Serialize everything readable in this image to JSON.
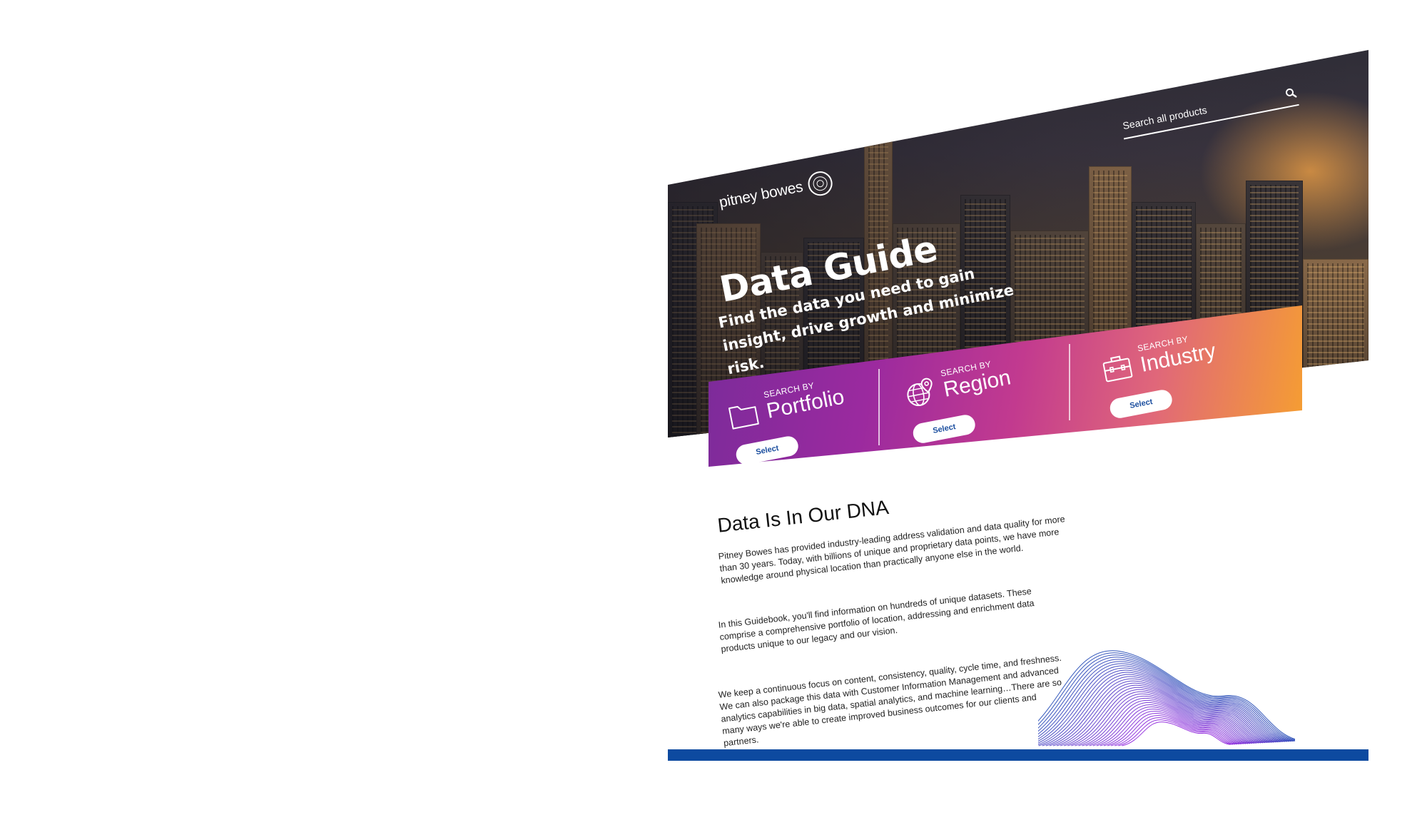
{
  "brand": {
    "name": "pitney bowes"
  },
  "search": {
    "placeholder": "Search all products"
  },
  "hero": {
    "title": "Data Guide",
    "subtitle": "Find the data you need to gain insight, drive growth and minimize risk."
  },
  "categories": [
    {
      "prefix": "SEARCH BY",
      "label": "Portfolio",
      "icon": "folder-icon",
      "button": "Select"
    },
    {
      "prefix": "SEARCH BY",
      "label": "Region",
      "icon": "globe-pin-icon",
      "button": "Select"
    },
    {
      "prefix": "SEARCH BY",
      "label": "Industry",
      "icon": "briefcase-icon",
      "button": "Select"
    }
  ],
  "about": {
    "title": "Data Is In Our DNA",
    "paragraphs": [
      "Pitney Bowes has provided industry-leading address validation and data quality for more than 30 years. Today, with billions of unique and proprietary data points, we have more knowledge around physical location than practically anyone else in the world.",
      "In this Guidebook, you'll find information on hundreds of unique datasets. These comprise a comprehensive portfolio of location, addressing and enrichment data products unique to our legacy and our vision.",
      "We keep a continuous focus on content, consistency, quality, cycle time, and freshness. We can also package this data with Customer Information Management and advanced analytics capabilities in big data, spatial analytics, and machine learning…There are so many ways we're able to create improved business outcomes for our clients and partners."
    ]
  },
  "colors": {
    "accent_blue": "#0d4aa0",
    "gradient_start": "#7b2b9a",
    "gradient_mid": "#c23a8f",
    "gradient_end": "#f6a02f"
  }
}
